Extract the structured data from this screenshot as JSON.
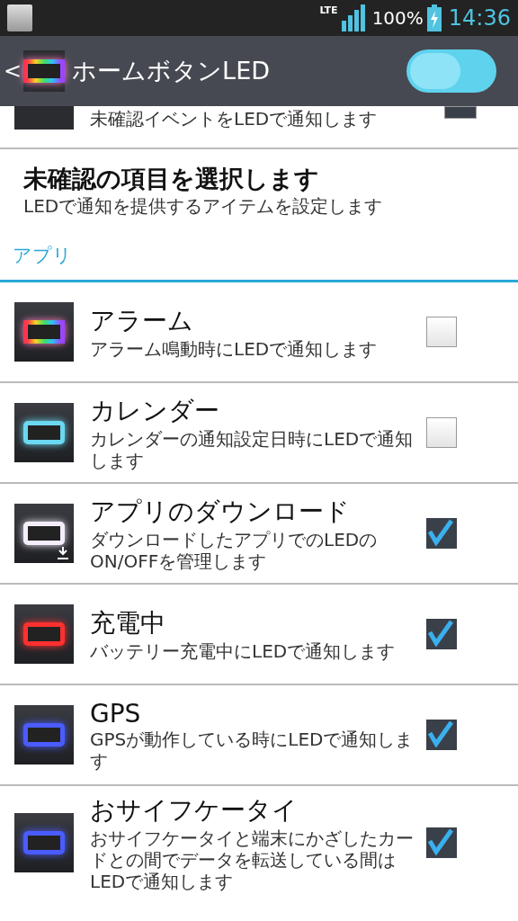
{
  "status_bar": {
    "battery": "100%",
    "time": "14:36",
    "network": "LTE"
  },
  "header": {
    "title": "ホームボタンLED",
    "back": "<",
    "on": true
  },
  "partial_item": {
    "summary": "未確認イベントをLEDで通知します",
    "checked": true
  },
  "select_item": {
    "title": "未確認の項目を選択します",
    "summary": "LEDで通知を提供するアイテムを設定します"
  },
  "section": {
    "title": "アプリ"
  },
  "items": [
    {
      "title": "アラーム",
      "summary": "アラーム鳴動時にLEDで通知します",
      "checked": false,
      "kind": "rainbow"
    },
    {
      "title": "カレンダー",
      "summary": "カレンダーの通知設定日時にLEDで通知します",
      "checked": false,
      "kind": "plain",
      "color": "#6ad8f0"
    },
    {
      "title": "アプリのダウンロード",
      "summary": "ダウンロードしたアプリでのLEDのON/OFFを管理します",
      "checked": true,
      "kind": "download",
      "color": "#f4eefc"
    },
    {
      "title": "充電中",
      "summary": "バッテリー充電中にLEDで通知します",
      "checked": true,
      "kind": "plain",
      "color": "#ff3030"
    },
    {
      "title": "GPS",
      "summary": "GPSが動作している時にLEDで通知します",
      "checked": true,
      "kind": "plain",
      "color": "#4a5cff"
    },
    {
      "title": "おサイフケータイ",
      "summary": "おサイフケータイと端末にかざしたカードとの間でデータを転送している間はLEDで通知します",
      "checked": true,
      "kind": "plain",
      "color": "#4a5cff"
    }
  ]
}
